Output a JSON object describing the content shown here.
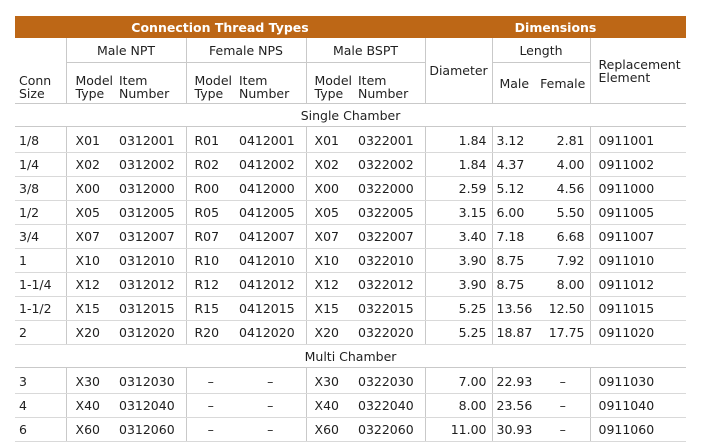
{
  "header": {
    "connection_thread_types": "Connection Thread Types",
    "dimensions": "Dimensions"
  },
  "groups": {
    "male_npt": "Male NPT",
    "female_nps": "Female NPS",
    "male_bspt": "Male BSPT",
    "length": "Length"
  },
  "subheaders": {
    "conn_size": [
      "Conn",
      "Size"
    ],
    "model_type": [
      "Model",
      "Type"
    ],
    "item_number": [
      "Item",
      "Number"
    ],
    "diameter": "Diameter",
    "male": "Male",
    "female": "Female",
    "replacement": [
      "Replacement",
      "Element"
    ]
  },
  "sections": [
    {
      "title": "Single Chamber",
      "rows": [
        [
          "1/8",
          "X01",
          "0312001",
          "R01",
          "0412001",
          "X01",
          "0322001",
          "1.84",
          "3.12",
          "2.81",
          "0911001"
        ],
        [
          "1/4",
          "X02",
          "0312002",
          "R02",
          "0412002",
          "X02",
          "0322002",
          "1.84",
          "4.37",
          "4.00",
          "0911002"
        ],
        [
          "3/8",
          "X00",
          "0312000",
          "R00",
          "0412000",
          "X00",
          "0322000",
          "2.59",
          "5.12",
          "4.56",
          "0911000"
        ],
        [
          "1/2",
          "X05",
          "0312005",
          "R05",
          "0412005",
          "X05",
          "0322005",
          "3.15",
          "6.00",
          "5.50",
          "0911005"
        ],
        [
          "3/4",
          "X07",
          "0312007",
          "R07",
          "0412007",
          "X07",
          "0322007",
          "3.40",
          "7.18",
          "6.68",
          "0911007"
        ],
        [
          "1",
          "X10",
          "0312010",
          "R10",
          "0412010",
          "X10",
          "0322010",
          "3.90",
          "8.75",
          "7.92",
          "0911010"
        ],
        [
          "1-1/4",
          "X12",
          "0312012",
          "R12",
          "0412012",
          "X12",
          "0322012",
          "3.90",
          "8.75",
          "8.00",
          "0911012"
        ],
        [
          "1-1/2",
          "X15",
          "0312015",
          "R15",
          "0412015",
          "X15",
          "0322015",
          "5.25",
          "13.56",
          "12.50",
          "0911015"
        ],
        [
          "2",
          "X20",
          "0312020",
          "R20",
          "0412020",
          "X20",
          "0322020",
          "5.25",
          "18.87",
          "17.75",
          "0911020"
        ]
      ]
    },
    {
      "title": "Multi Chamber",
      "rows": [
        [
          "3",
          "X30",
          "0312030",
          "–",
          "–",
          "X30",
          "0322030",
          "7.00",
          "22.93",
          "–",
          "0911030"
        ],
        [
          "4",
          "X40",
          "0312040",
          "–",
          "–",
          "X40",
          "0322040",
          "8.00",
          "23.56",
          "–",
          "0911040"
        ],
        [
          "6",
          "X60",
          "0312060",
          "–",
          "–",
          "X60",
          "0322060",
          "11.00",
          "30.93",
          "–",
          "0911060"
        ]
      ]
    }
  ]
}
